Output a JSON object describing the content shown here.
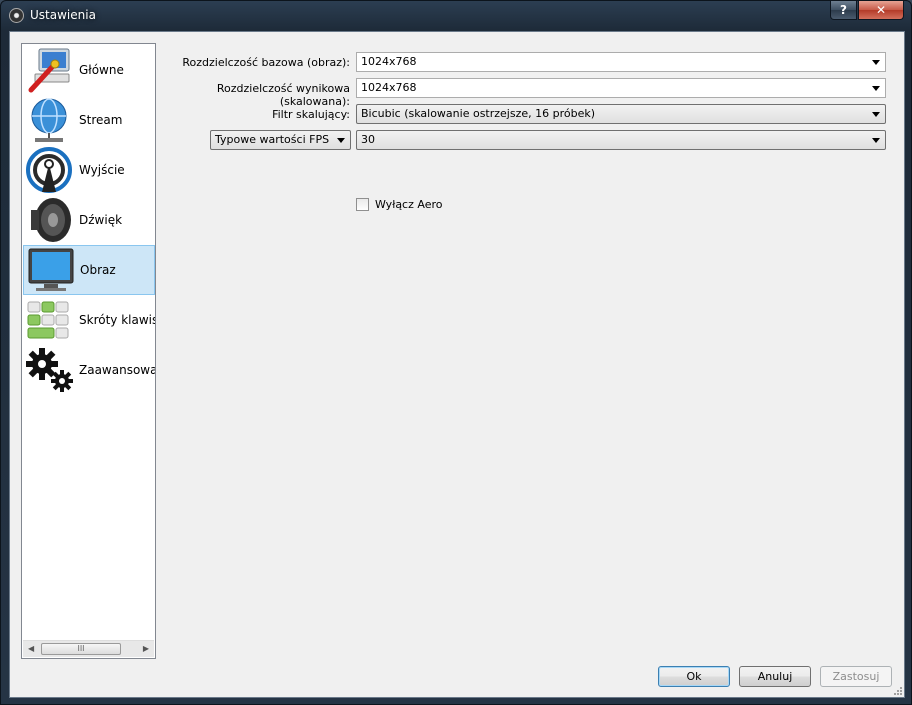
{
  "window": {
    "title": "Ustawienia",
    "help_label": "?",
    "close_label": "✕"
  },
  "sidebar": {
    "items": [
      {
        "label": "Główne",
        "icon": "general-icon"
      },
      {
        "label": "Stream",
        "icon": "stream-globe-icon"
      },
      {
        "label": "Wyjście",
        "icon": "output-broadcast-icon"
      },
      {
        "label": "Dźwięk",
        "icon": "speaker-icon"
      },
      {
        "label": "Obraz",
        "icon": "monitor-icon",
        "selected": true
      },
      {
        "label": "Skróty klawiszowe",
        "icon": "keyboard-shortcuts-icon"
      },
      {
        "label": "Zaawansowane",
        "icon": "gears-icon"
      }
    ],
    "scroll_thumb": "III"
  },
  "video": {
    "base_res_label": "Rozdzielczość bazowa (obraz):",
    "base_res_value": "1024x768",
    "output_res_label": "Rozdzielczość wynikowa (skalowana):",
    "output_res_value": "1024x768",
    "filter_label": "Filtr skalujący:",
    "filter_value": "Bicubic (skalowanie ostrzejsze, 16 próbek)",
    "fps_type_value": "Typowe wartości FPS",
    "fps_value": "30",
    "aero_label": "Wyłącz Aero"
  },
  "buttons": {
    "ok": "Ok",
    "cancel": "Anuluj",
    "apply": "Zastosuj"
  }
}
